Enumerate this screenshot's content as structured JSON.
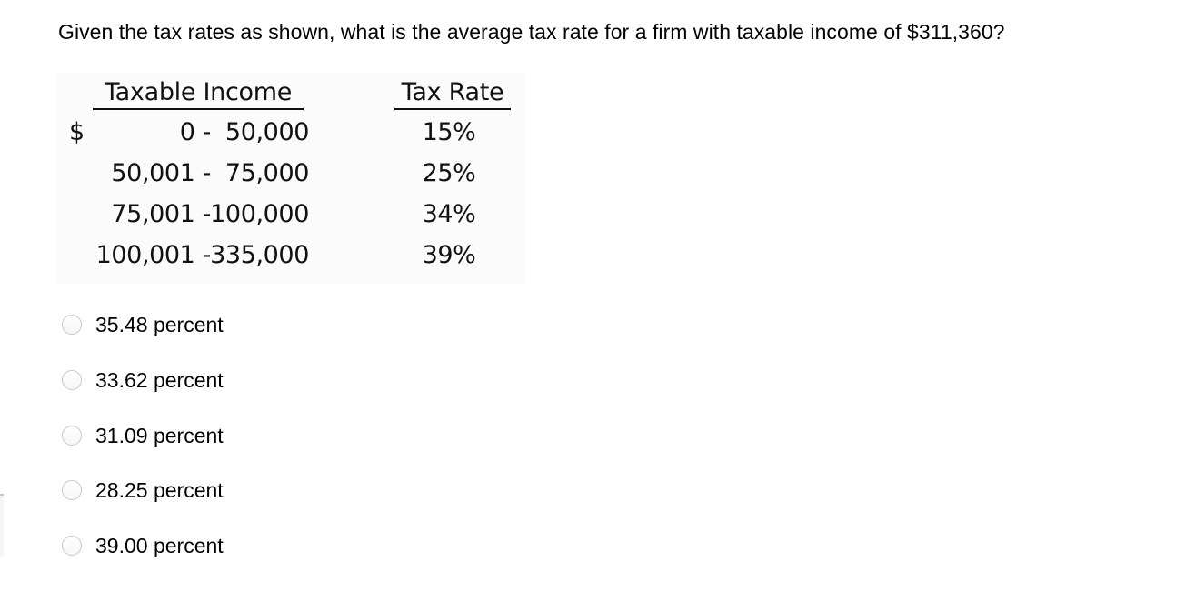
{
  "question": {
    "text": "Given the tax rates as shown, what is the average tax rate for a firm with taxable income of $311,360?"
  },
  "tax_table": {
    "headers": {
      "income": "Taxable Income",
      "rate": "Tax Rate"
    },
    "currency_symbol": "$",
    "rows": [
      {
        "low": "0 -",
        "high": "50,000",
        "rate": "15%"
      },
      {
        "low": "50,001 -",
        "high": "75,000",
        "rate": "25%"
      },
      {
        "low": "75,001 -",
        "high": "100,000",
        "rate": "34%"
      },
      {
        "low": "100,001 -",
        "high": "335,000",
        "rate": "39%"
      }
    ]
  },
  "options": [
    {
      "label": "35.48 percent",
      "selected": false
    },
    {
      "label": "33.62 percent",
      "selected": false
    },
    {
      "label": "31.09 percent",
      "selected": false
    },
    {
      "label": "28.25 percent",
      "selected": false
    },
    {
      "label": "39.00 percent",
      "selected": false
    }
  ]
}
